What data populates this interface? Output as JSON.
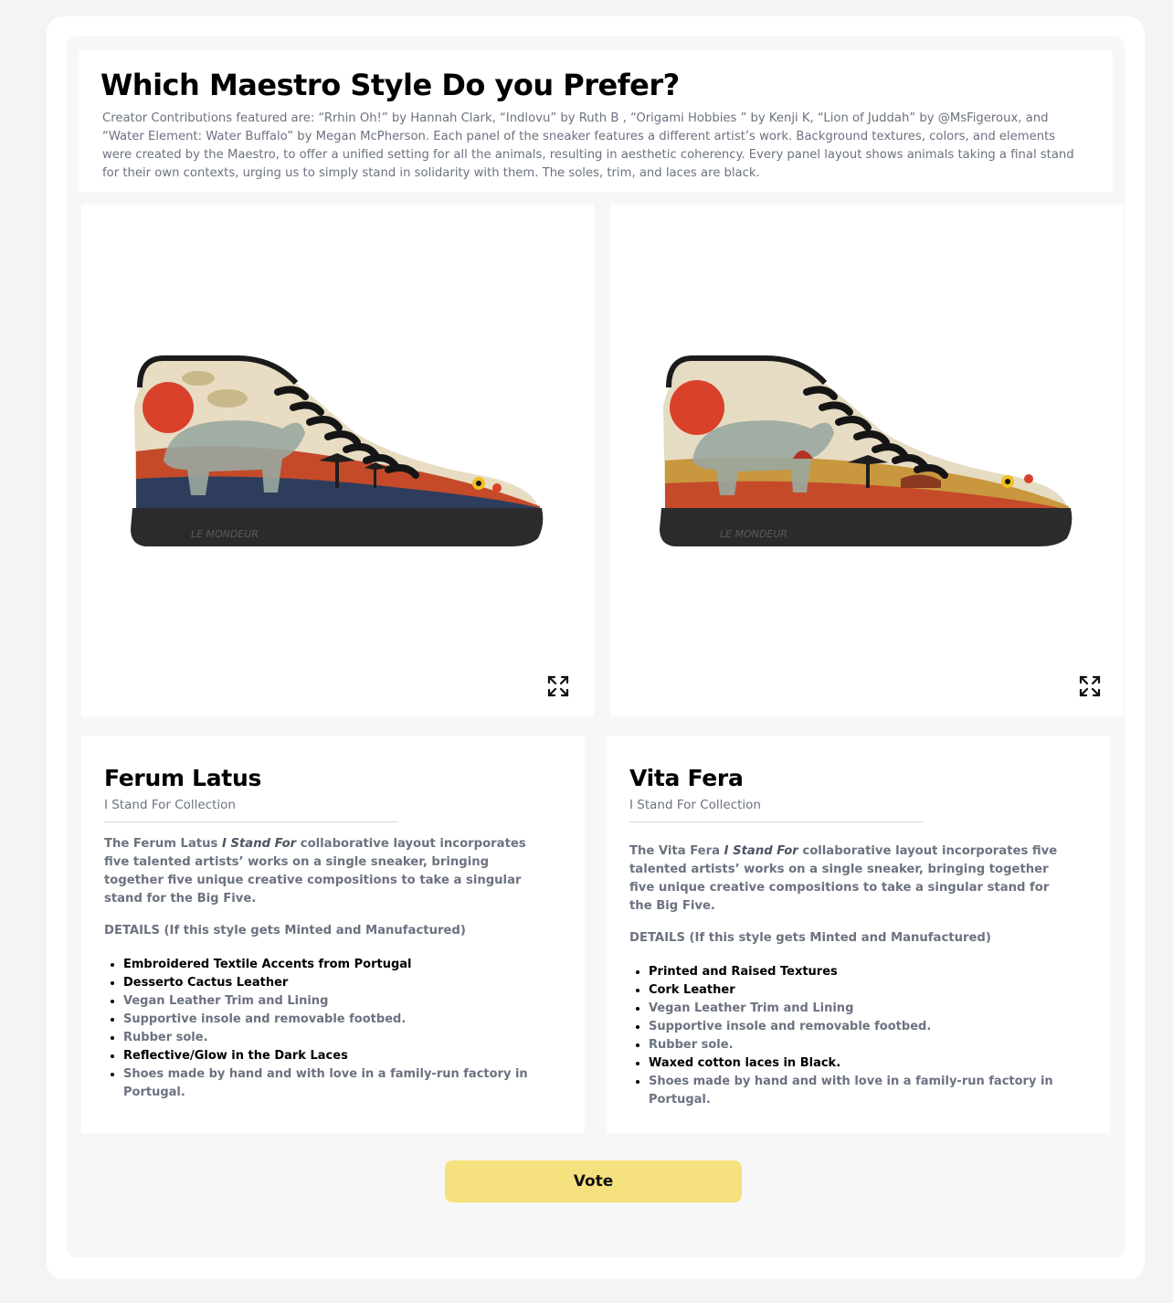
{
  "header": {
    "title": "Which Maestro Style Do you Prefer?",
    "description": "Creator Contributions featured are: “Rrhin Oh!”  by Hannah Clark, “Indlovu” by Ruth B , “Origami Hobbies ” by Kenji K, “Lion of Juddah” by @MsFigeroux, and “Water Element: Water Buffalo” by Megan McPherson. Each panel of the sneaker features a different artist’s work. Background textures, colors, and elements were created by the Maestro, to offer a unified setting for all the animals, resulting in aesthetic coherency. Every panel layout shows animals taking a final stand for their own contexts, urging us to simply stand in solidarity with them. The soles, trim, and laces are black."
  },
  "colors": {
    "accent_button": "#f5e17e",
    "muted_text": "#6b7280",
    "sole": "#2b2b2d",
    "sun": "#d9412b"
  },
  "options": [
    {
      "image_alt": "Ferum Latus sneaker",
      "brand_mark": "LE MONDEUR",
      "expand_icon": "expand-icon",
      "name": "Ferum Latus",
      "collection": "I Stand For Collection",
      "desc_pre": "The Ferum Latus ",
      "desc_em": "I Stand For",
      "desc_post": " collaborative layout incorporates five talented artists’ works on a single sneaker, bringing together five unique creative compositions to take a singular stand for the Big Five.",
      "details_heading": "DETAILS (If this style gets Minted and Manufactured)",
      "features": [
        "Embroidered Textile Accents from Portugal",
        "Desserto Cactus Leather",
        "Vegan Leather Trim and Lining",
        "Supportive insole and removable footbed.",
        "Rubber sole.",
        "Reflective/Glow in the Dark Laces",
        "Shoes made by hand and with love in a family-run factory in Portugal."
      ]
    },
    {
      "image_alt": "Vita Fera sneaker",
      "brand_mark": "LE MONDEUR",
      "expand_icon": "expand-icon",
      "name": "Vita Fera",
      "collection": "I Stand For Collection",
      "desc_pre": "The Vita Fera ",
      "desc_em": "I Stand For",
      "desc_post": " collaborative layout incorporates five talented artists’ works on a single sneaker, bringing together five unique creative compositions to take a singular stand for the Big Five.",
      "details_heading": "DETAILS (If this style gets Minted and Manufactured)",
      "features": [
        "Printed and Raised Textures",
        "Cork Leather",
        "Vegan Leather Trim and Lining",
        "Supportive insole and removable footbed.",
        "Rubber sole.",
        "Waxed cotton laces in Black.",
        "Shoes made by hand and with love in a family-run factory in Portugal."
      ]
    }
  ],
  "vote": {
    "label": "Vote"
  }
}
